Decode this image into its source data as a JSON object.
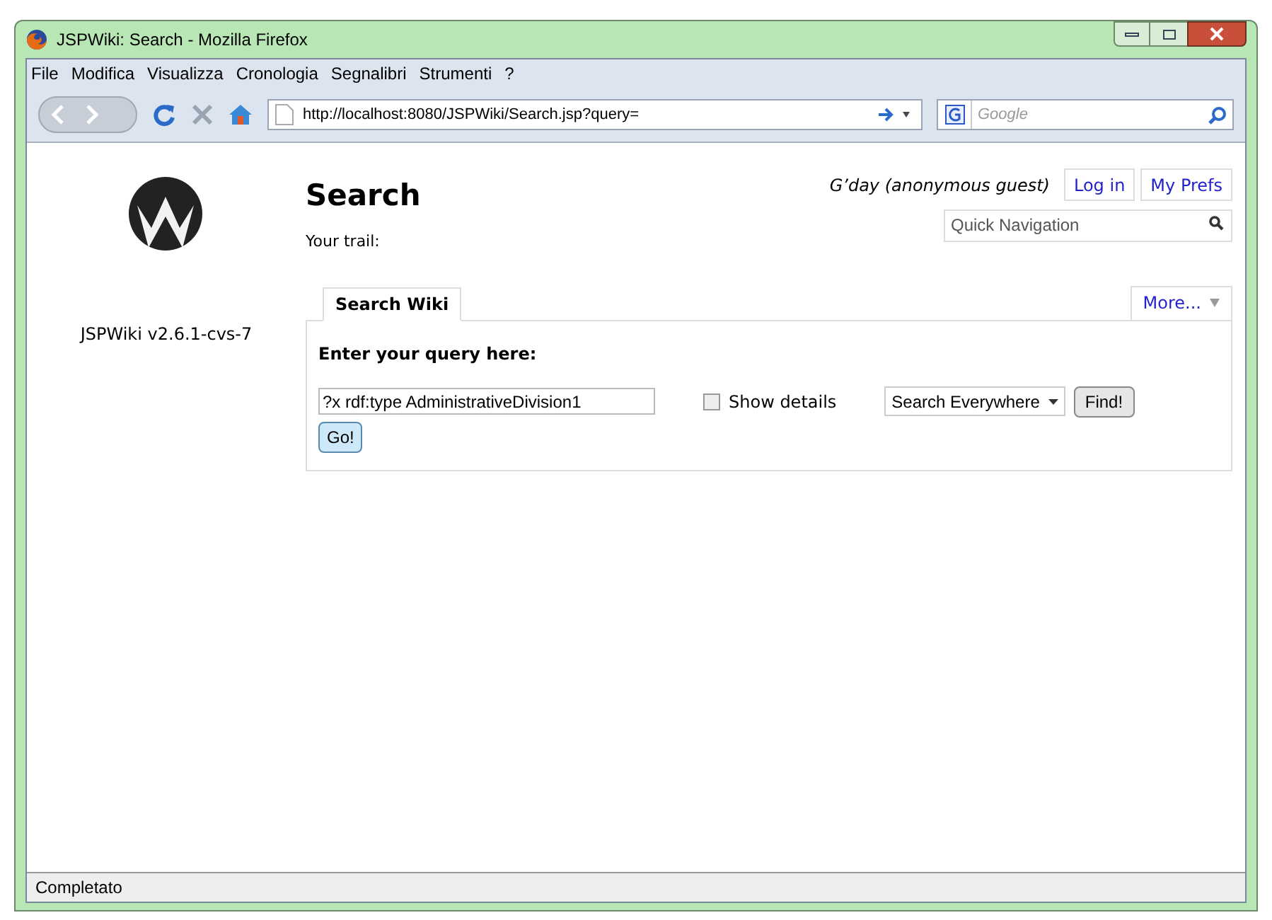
{
  "window": {
    "title": "JSPWiki: Search - Mozilla Firefox"
  },
  "menu": [
    "File",
    "Modifica",
    "Visualizza",
    "Cronologia",
    "Segnalibri",
    "Strumenti",
    "?"
  ],
  "address_bar": {
    "url": "http://localhost:8080/JSPWiki/Search.jsp?query="
  },
  "search_bar": {
    "placeholder": "Google"
  },
  "page": {
    "version": "JSPWiki v2.6.1-cvs-7",
    "heading": "Search",
    "greeting": "G’day (anonymous guest)",
    "user_links": [
      "Log in",
      "My Prefs"
    ],
    "quick_nav": {
      "placeholder": "Quick Navigation"
    },
    "trail": "Your trail:",
    "tabs": [
      {
        "label": "Search Wiki",
        "selected": true
      }
    ],
    "more": "More...",
    "form": {
      "prompt": "Enter your query here:",
      "query": "?x rdf:type AdministrativeDivision1",
      "show_details": {
        "label": "Show details",
        "checked": false
      },
      "scope": "Search Everywhere",
      "find": "Find!",
      "go": "Go!"
    }
  },
  "status_bar": {
    "text": "Completato"
  }
}
